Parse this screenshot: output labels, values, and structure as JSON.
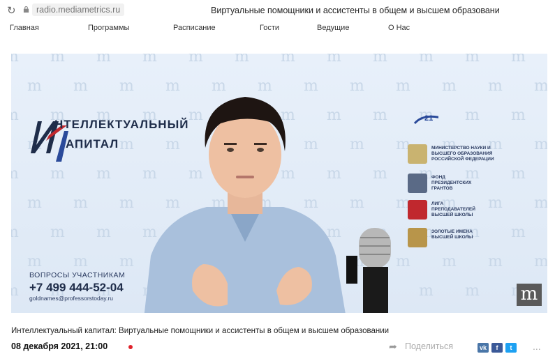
{
  "browser": {
    "url": "radio.mediametrics.ru",
    "page_heading": "Виртуальные помощники и ассистенты в общем и высшем образовани"
  },
  "nav": {
    "items": [
      "Главная",
      "Программы",
      "Расписание",
      "Гости",
      "Ведущие",
      "О Нас"
    ]
  },
  "video": {
    "show_logo_line1": "НТЕЛЛЕКТУАЛЬНЫЙ",
    "show_logo_line2": "АПИТАЛ",
    "contact_question": "ВОПРОСЫ УЧАСТНИКАМ",
    "contact_phone": "+7 499 444-52-04",
    "contact_email": "goldnames@professorstoday.ru",
    "pattern_letter": "m",
    "brand_badge": "m",
    "sponsors": [
      {
        "text": "",
        "icon": "agency-21-logo",
        "color": "#2a4a9a"
      },
      {
        "text": "Министерство науки и высшего образования Российской Федерации",
        "icon": "ministry-emblem-icon",
        "color": "#8a7a3a"
      },
      {
        "text": "Фонд президентских грантов",
        "icon": "grants-fund-icon",
        "color": "#3a4a6a"
      },
      {
        "text": "Лига преподавателей высшей школы",
        "icon": "teachers-league-icon",
        "color": "#c0282e"
      },
      {
        "text": "Золотые имена высшей школы",
        "icon": "golden-names-icon",
        "color": "#b8954a"
      }
    ]
  },
  "caption": {
    "title": "Интеллектуальный капитал: Виртуальные помощники и ассистенты в общем и высшем образовании",
    "date": "08 декабря 2021, 21:00"
  },
  "share": {
    "label": "Поделиться",
    "icon": "share-arrow-icon",
    "networks": [
      {
        "label": "vk",
        "icon": "vk-icon",
        "color": "#4a76a8"
      },
      {
        "label": "f",
        "icon": "facebook-icon",
        "color": "#3b5998"
      },
      {
        "label": "t",
        "icon": "twitter-icon",
        "color": "#1da1f2"
      }
    ],
    "more_label": "..."
  },
  "colors": {
    "live_indicator": "#e0222b",
    "brand_navy": "#1f2d4a"
  }
}
